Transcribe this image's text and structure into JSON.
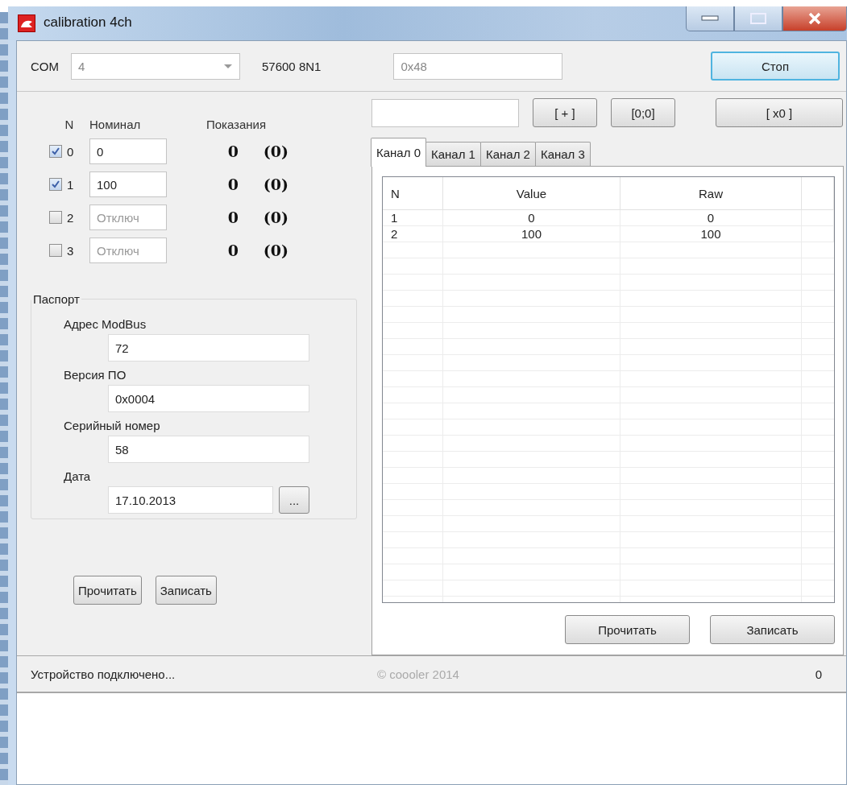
{
  "window": {
    "title": "calibration 4ch"
  },
  "connection": {
    "port_label": "COM",
    "port": "4",
    "settings": "57600 8N1",
    "address": "0x48",
    "stop_button": "Стоп"
  },
  "channels_header": {
    "n": "N",
    "nominal": "Номинал",
    "readings": "Показания"
  },
  "channels": [
    {
      "n": "0",
      "checked": true,
      "nominal": "0",
      "reading": "0",
      "raw": "(0)"
    },
    {
      "n": "1",
      "checked": true,
      "nominal": "100",
      "reading": "0",
      "raw": "(0)"
    },
    {
      "n": "2",
      "checked": false,
      "placeholder": "Отключ",
      "reading": "0",
      "raw": "(0)"
    },
    {
      "n": "3",
      "checked": false,
      "placeholder": "Отключ",
      "reading": "0",
      "raw": "(0)"
    }
  ],
  "passport": {
    "title": "Паспорт",
    "fields": [
      {
        "label": "Адрес ModBus",
        "value": "72"
      },
      {
        "label": "Версия ПО",
        "value": "0x0004"
      },
      {
        "label": "Серийный номер",
        "value": "58"
      },
      {
        "label": "Дата",
        "value": "17.10.2013",
        "button": "..."
      }
    ]
  },
  "left_buttons": [
    "Прочитать",
    "Записать"
  ],
  "tools": {
    "buttons": [
      "[ + ]",
      "[0;0]",
      "[ x0 ]"
    ]
  },
  "tabs": [
    {
      "label": "Канал 0",
      "selected": true
    },
    {
      "label": "Канал 1",
      "selected": false
    },
    {
      "label": "Канал 2",
      "selected": false
    },
    {
      "label": "Канал 3",
      "selected": false
    }
  ],
  "table": {
    "columns": [
      "N",
      "Value",
      "Raw"
    ],
    "rows": [
      [
        "1",
        "0",
        "0"
      ],
      [
        "2",
        "100",
        "100"
      ]
    ]
  },
  "right_buttons": [
    "Прочитать",
    "Записать"
  ],
  "status_bar": {
    "message": "Устройство подключено...",
    "copyright": "© coooler 2014",
    "count": "0"
  }
}
